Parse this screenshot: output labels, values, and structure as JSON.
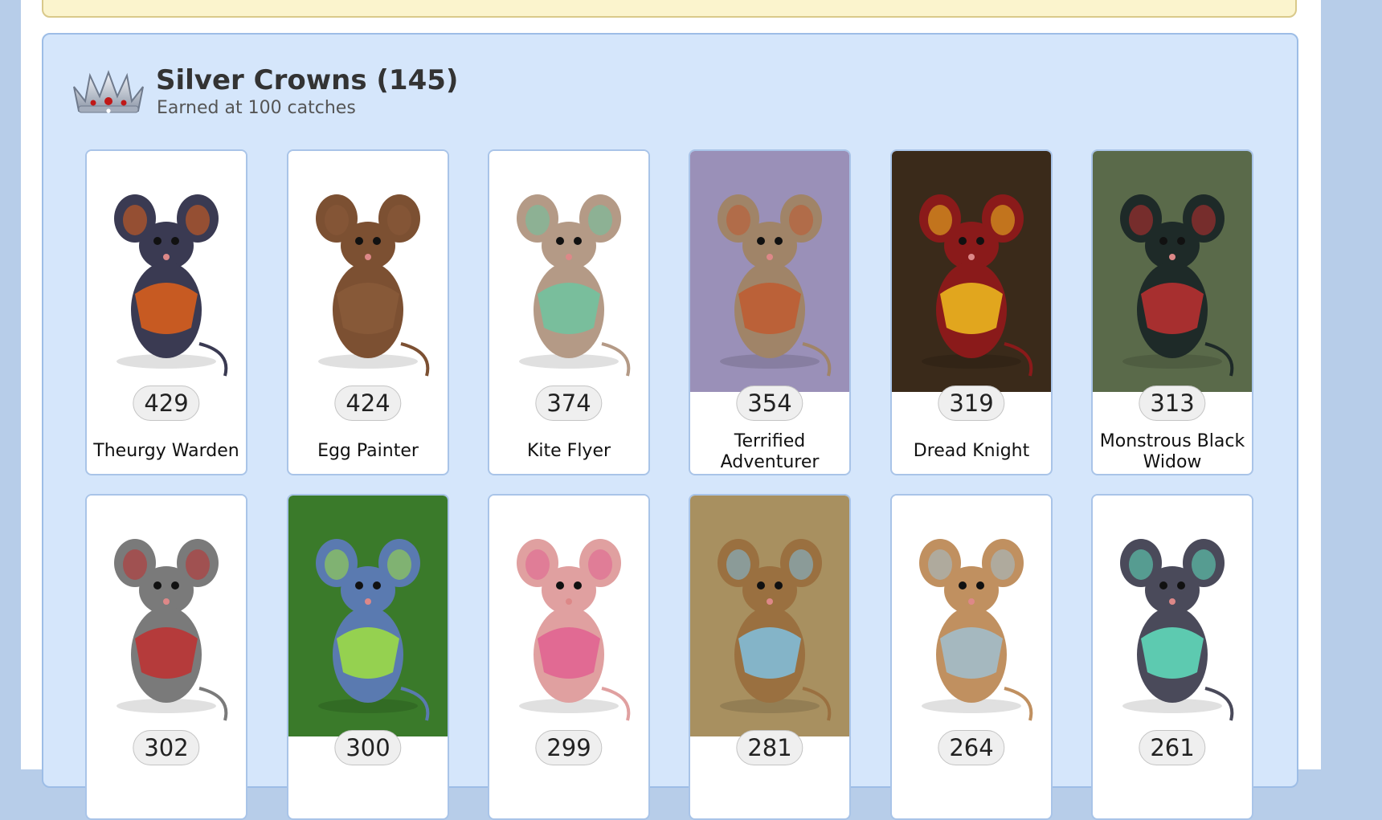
{
  "section": {
    "title": "Silver Crowns (145)",
    "subtitle": "Earned at 100 catches",
    "icon": "silver-crown-icon"
  },
  "cards": [
    {
      "count": "429",
      "name": "Theurgy Warden",
      "bg": "#ffffff",
      "accent": "#e0601a",
      "body": "#3a3a52"
    },
    {
      "count": "424",
      "name": "Egg Painter",
      "bg": "#ffffff",
      "accent": "#8a5a3a",
      "body": "#7c5032"
    },
    {
      "count": "374",
      "name": "Kite Flyer",
      "bg": "#ffffff",
      "accent": "#6ec4a0",
      "body": "#b49a86"
    },
    {
      "count": "354",
      "name": "Terrified Adventurer",
      "bg": "#9a90b8",
      "accent": "#c05a30",
      "body": "#a08468"
    },
    {
      "count": "319",
      "name": "Dread Knight",
      "bg": "#3a2a1a",
      "accent": "#f0c020",
      "body": "#8a1a1a"
    },
    {
      "count": "313",
      "name": "Monstrous Black Widow",
      "bg": "#5a6a4a",
      "accent": "#c03030",
      "body": "#1e2a28"
    },
    {
      "count": "302",
      "name": "",
      "bg": "#ffffff",
      "accent": "#c03030",
      "body": "#7a7a7a"
    },
    {
      "count": "300",
      "name": "",
      "bg": "#3a7a2a",
      "accent": "#a0e040",
      "body": "#5a7ab0"
    },
    {
      "count": "299",
      "name": "",
      "bg": "#ffffff",
      "accent": "#e06090",
      "body": "#e0a0a0"
    },
    {
      "count": "281",
      "name": "",
      "bg": "#a89060",
      "accent": "#80c0e0",
      "body": "#9a7040"
    },
    {
      "count": "264",
      "name": "",
      "bg": "#ffffff",
      "accent": "#a0c0d0",
      "body": "#c09060"
    },
    {
      "count": "261",
      "name": "",
      "bg": "#ffffff",
      "accent": "#60e0c0",
      "body": "#4a4a5a"
    }
  ]
}
